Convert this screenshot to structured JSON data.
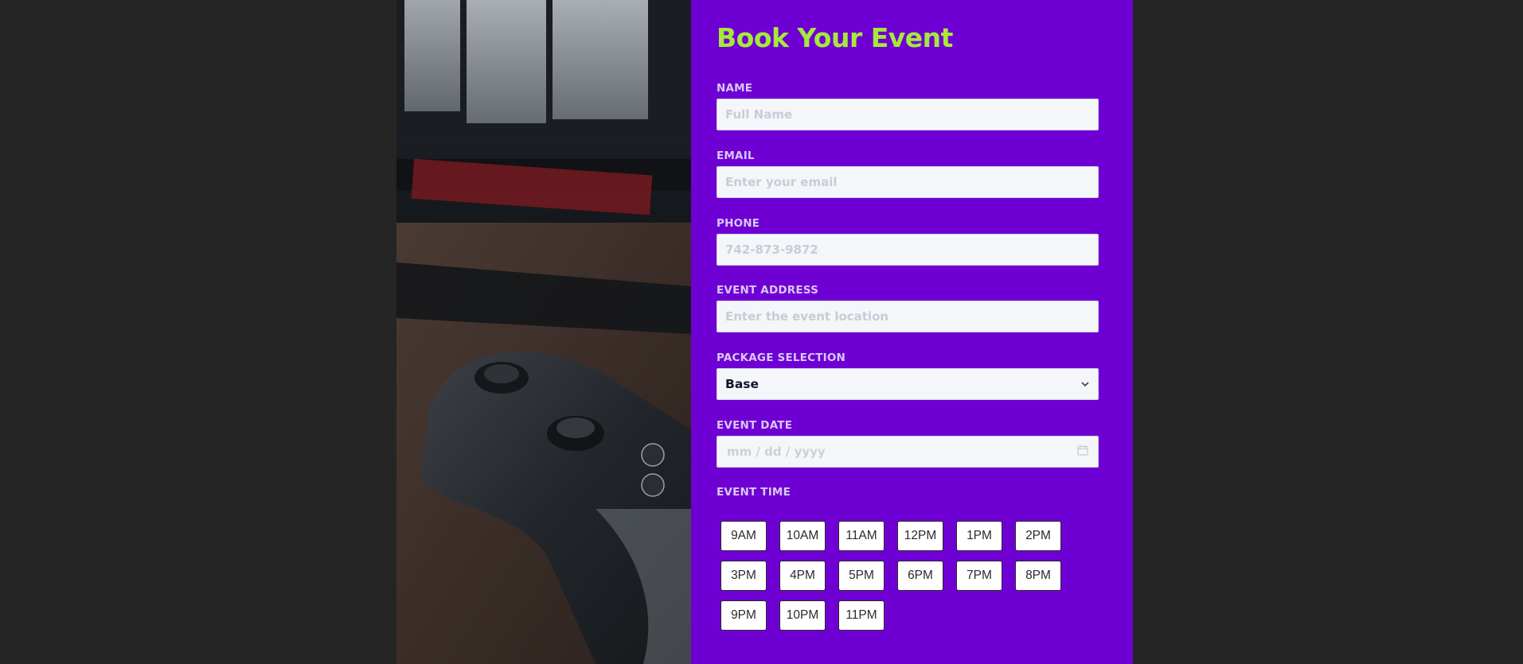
{
  "form": {
    "title": "Book Your Event",
    "name": {
      "label": "NAME",
      "placeholder": "Full Name",
      "value": ""
    },
    "email": {
      "label": "EMAIL",
      "placeholder": "Enter your email",
      "value": ""
    },
    "phone": {
      "label": "PHONE",
      "placeholder": "742-873-9872",
      "value": ""
    },
    "address": {
      "label": "EVENT ADDRESS",
      "placeholder": "Enter the event location",
      "value": ""
    },
    "package": {
      "label": "PACKAGE SELECTION",
      "selected": "Base"
    },
    "date": {
      "label": "EVENT DATE",
      "placeholder": "mm / dd / yyyy"
    },
    "time": {
      "label": "EVENT TIME",
      "rows": [
        [
          "9AM",
          "10AM",
          "11AM",
          "12PM",
          "1PM",
          "2PM"
        ],
        [
          "3PM",
          "4PM",
          "5PM",
          "6PM",
          "7PM",
          "8PM"
        ],
        [
          "9PM",
          "10PM",
          "11PM"
        ]
      ]
    }
  },
  "colors": {
    "page_bg": "#252525",
    "panel_bg": "#6f00d4",
    "title": "#a6e93a",
    "label": "#d7c9f3"
  },
  "icons": {
    "select": "chevron-down-icon",
    "date": "calendar-icon"
  }
}
